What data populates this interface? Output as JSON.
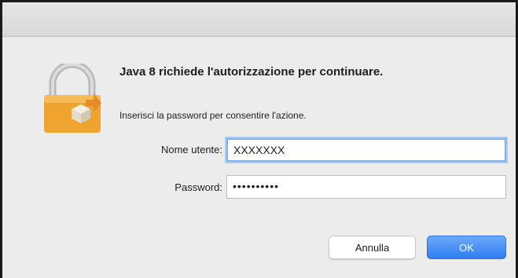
{
  "dialog": {
    "heading": "Java 8 richiede l'autorizzazione per continuare.",
    "subtext": "Inserisci la password per consentire l'azione.",
    "icon": "padlock-icon"
  },
  "form": {
    "username_label": "Nome utente:",
    "username_value": "XXXXXXX",
    "password_label": "Password:",
    "password_value": "••••••••••"
  },
  "buttons": {
    "cancel_label": "Annulla",
    "ok_label": "OK"
  },
  "colors": {
    "accent": "#3a86f2",
    "lock_body": "#f0a430",
    "focus_ring": "#7fb2ec"
  }
}
